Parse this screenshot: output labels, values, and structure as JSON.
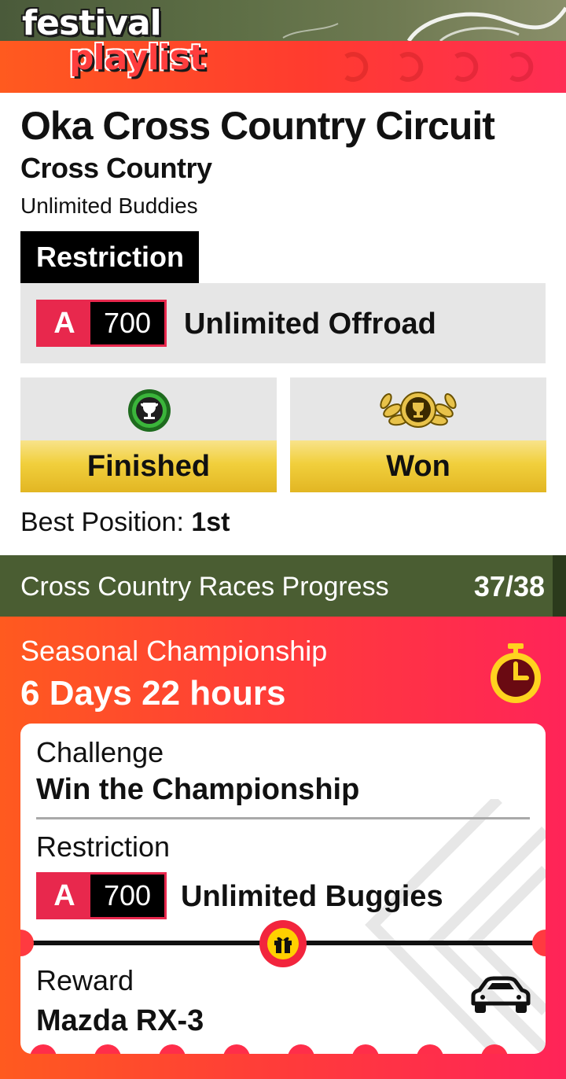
{
  "header": {
    "logo_line1": "festival",
    "logo_line2": "playlist"
  },
  "event": {
    "title": "Oka Cross Country Circuit",
    "type": "Cross Country",
    "subtitle": "Unlimited Buddies",
    "restriction_heading": "Restriction",
    "restriction": {
      "class_letter": "A",
      "pi": "700",
      "name": "Unlimited Offroad"
    },
    "status": [
      {
        "label": "Finished",
        "icon": "trophy-icon"
      },
      {
        "label": "Won",
        "icon": "laurel-trophy-icon"
      }
    ],
    "best_position_label": "Best Position: ",
    "best_position_value": "1st"
  },
  "progress": {
    "label": "Cross Country Races Progress",
    "count": "37/38"
  },
  "championship": {
    "label": "Seasonal Championship",
    "time_left": "6 Days 22 hours",
    "timer_icon": "stopwatch-icon",
    "challenge_label": "Challenge",
    "challenge_value": "Win the Championship",
    "restriction_label": "Restriction",
    "restriction": {
      "class_letter": "A",
      "pi": "700",
      "name": "Unlimited Buggies"
    },
    "reward_label": "Reward",
    "reward_value": "Mazda RX-3",
    "reward_icon": "car-icon",
    "gift_icon": "gift-icon"
  },
  "colors": {
    "accent_orange": "#ff5a1f",
    "accent_pink": "#ff2458",
    "class_a_red": "#e8284d",
    "progress_green": "#4a5d32",
    "gold": "#f1cf3c"
  }
}
